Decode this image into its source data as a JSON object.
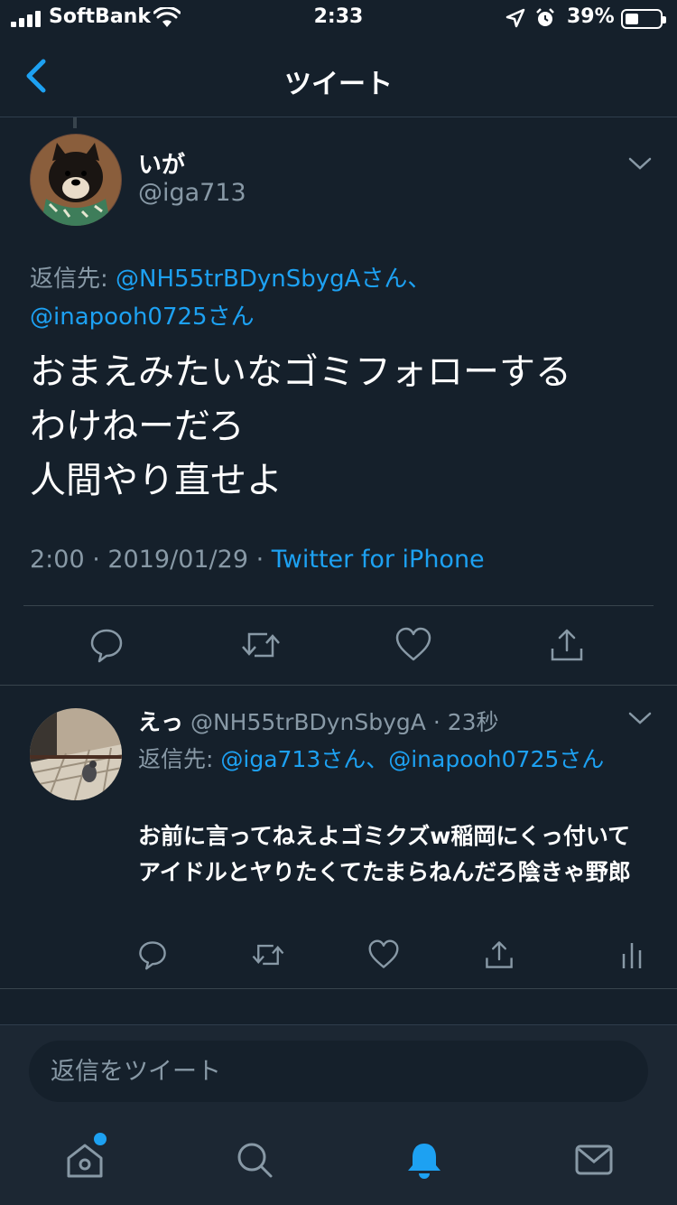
{
  "status_bar": {
    "carrier": "SoftBank",
    "time": "2:33",
    "battery_percent": "39%",
    "battery_level": 0.39
  },
  "header": {
    "title": "ツイート"
  },
  "main_tweet": {
    "name": "いが",
    "handle": "@iga713",
    "reply_to_label": "返信先: ",
    "reply_to_mention_1": "@NH55trBDynSbygAさん、",
    "reply_to_mention_2": "@inapooh0725さん",
    "text": "おまえみたいなゴミフォローする\nわけねーだろ\n人間やり直せよ",
    "timestamp": "2:00 · 2019/01/29 · ",
    "source": "Twitter for iPhone"
  },
  "reply_tweet": {
    "name": "えっ",
    "handle": " @NH55trBDynSbygA",
    "time": " · 23秒",
    "reply_to_label": "返信先: ",
    "reply_to_mention_1": "@iga713さん、",
    "reply_to_mention_2": "@inapooh0725さん",
    "text": "お前に言ってねえよゴミクズw稲岡にくっ付いてアイドルとヤりたくてたまらねんだろ陰きゃ野郎"
  },
  "composer": {
    "placeholder": "返信をツイート"
  },
  "colors": {
    "background": "#15202b",
    "accent": "#1da1f2",
    "secondary_text": "#8899a6",
    "divider": "#38444d"
  },
  "icons": {
    "back": "chevron-left-icon",
    "reply": "reply-icon",
    "retweet": "retweet-icon",
    "like": "heart-icon",
    "share": "share-icon",
    "analytics": "analytics-icon",
    "home": "home-icon",
    "search": "search-icon",
    "notifications": "bell-icon",
    "messages": "mail-icon"
  }
}
